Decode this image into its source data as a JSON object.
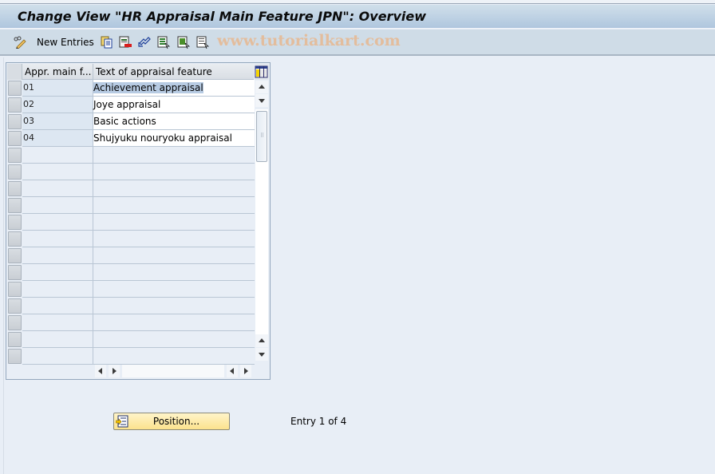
{
  "window": {
    "title": "Change View \"HR Appraisal Main Feature JPN\": Overview"
  },
  "toolbar": {
    "new_entries_label": "New Entries",
    "icons": [
      "display-change-icon",
      "copy-icon",
      "delete-icon",
      "undo-icon",
      "select-all-icon",
      "select-block-icon",
      "deselect-all-icon"
    ]
  },
  "watermark": "www.tutorialkart.com",
  "table": {
    "columns": [
      "Appr. main f...",
      "Text of appraisal feature"
    ],
    "rows": [
      {
        "code": "01",
        "text": "Achievement appraisal"
      },
      {
        "code": "02",
        "text": "Joye appraisal"
      },
      {
        "code": "03",
        "text": "Basic actions"
      },
      {
        "code": "04",
        "text": "Shujyuku nouryoku appraisal"
      }
    ],
    "empty_row_count": 13
  },
  "footer": {
    "position_button_label": "Position...",
    "entry_info": "Entry 1 of 4"
  }
}
